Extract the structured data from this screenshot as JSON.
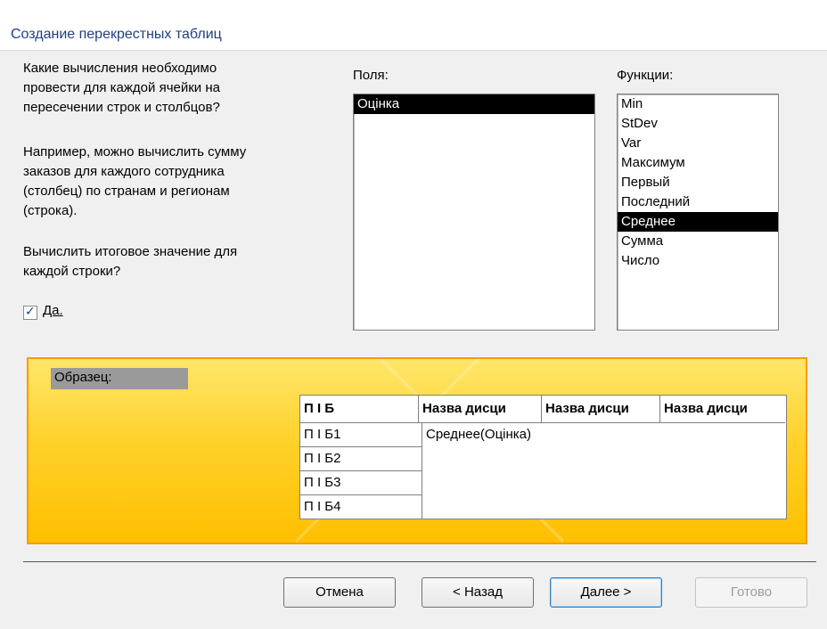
{
  "window": {
    "title": "Создание перекрестных таблиц"
  },
  "left_text": {
    "question": [
      "Какие вычисления необходимо",
      "провести для каждой ячейки на",
      "пересечении строк и столбцов?"
    ],
    "example": [
      "Например, можно вычислить сумму",
      "заказов для каждого сотрудника",
      "(столбец) по странам и регионам",
      "(строка)."
    ],
    "total_question": [
      "Вычислить итоговое значение для",
      "каждой строки?"
    ],
    "checkbox_label": "Да.",
    "checkbox_checked": true
  },
  "fields": {
    "label": "Поля:",
    "items": [
      {
        "label": "Оцінка",
        "selected": true
      }
    ]
  },
  "functions": {
    "label": "Функции:",
    "items": [
      {
        "label": "Min",
        "selected": false
      },
      {
        "label": "StDev",
        "selected": false
      },
      {
        "label": "Var",
        "selected": false
      },
      {
        "label": "Максимум",
        "selected": false
      },
      {
        "label": "Первый",
        "selected": false
      },
      {
        "label": "Последний",
        "selected": false
      },
      {
        "label": "Среднее",
        "selected": true
      },
      {
        "label": "Сумма",
        "selected": false
      },
      {
        "label": "Число",
        "selected": false
      }
    ]
  },
  "sample": {
    "label": "Образец:",
    "row_header": "П І Б",
    "column_headers": [
      "Назва дисци",
      "Назва дисци",
      "Назва дисци"
    ],
    "rows": [
      "П І Б1",
      "П І Б2",
      "П І Б3",
      "П І Б4"
    ],
    "cell": "Среднее(Оцінка)"
  },
  "buttons": {
    "cancel": "Отмена",
    "back": "< Назад",
    "next": "Далее >",
    "finish": "Готово"
  }
}
